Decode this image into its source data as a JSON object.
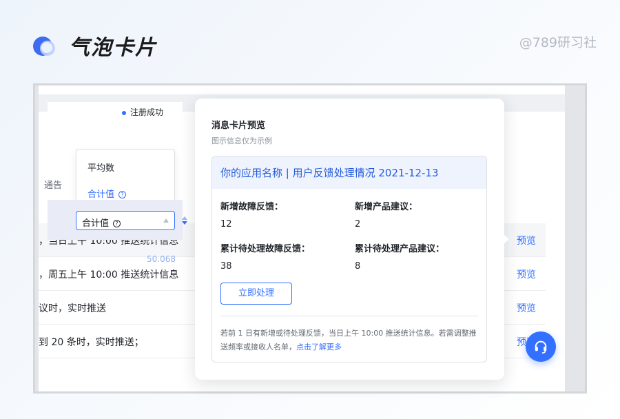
{
  "header": {
    "title": "气泡卡片",
    "brand": "@789研习社"
  },
  "background_table": {
    "status_label": "注册成功",
    "side_label": "通告",
    "rows": [
      {
        "text": "，当日上午 10:00 推送统计信息",
        "action": "预览"
      },
      {
        "text": "，周五上午 10:00 推送统计信息",
        "action": "预览"
      },
      {
        "text": "议时，实时推送",
        "action": "预览"
      },
      {
        "text": "到 20 条时，实时推送；",
        "action": "预览"
      }
    ],
    "ghost_text": "50.068"
  },
  "dropdown": {
    "options": [
      "平均数",
      "合计值"
    ],
    "selected": "合计值",
    "help_glyph": "?"
  },
  "card": {
    "title": "消息卡片预览",
    "subtitle": "图示信息仅为示例",
    "header_text": "你的应用名称 | 用户反馈处理情况 2021-12-13",
    "fields": [
      {
        "label": "新增故障反馈：",
        "value": "12"
      },
      {
        "label": "新增产品建议：",
        "value": "2"
      },
      {
        "label": "累计待处理故障反馈：",
        "value": "38"
      },
      {
        "label": "累计待处理产品建议：",
        "value": "8"
      }
    ],
    "button_label": "立即处理",
    "footer_text": "若前 1 日有新增或待处理反馈，当日上午 10:00 推送统计信息。若需调整推送频率或接收人名单，",
    "footer_link": "点击了解更多"
  },
  "colors": {
    "accent": "#3370ff",
    "header_bg": "#eef3fe",
    "text": "#1f2329",
    "muted": "#8f959e"
  },
  "icons": [
    "bubble-logo-icon",
    "help-circle-icon",
    "caret-up-icon",
    "sort-icon",
    "headset-icon"
  ]
}
